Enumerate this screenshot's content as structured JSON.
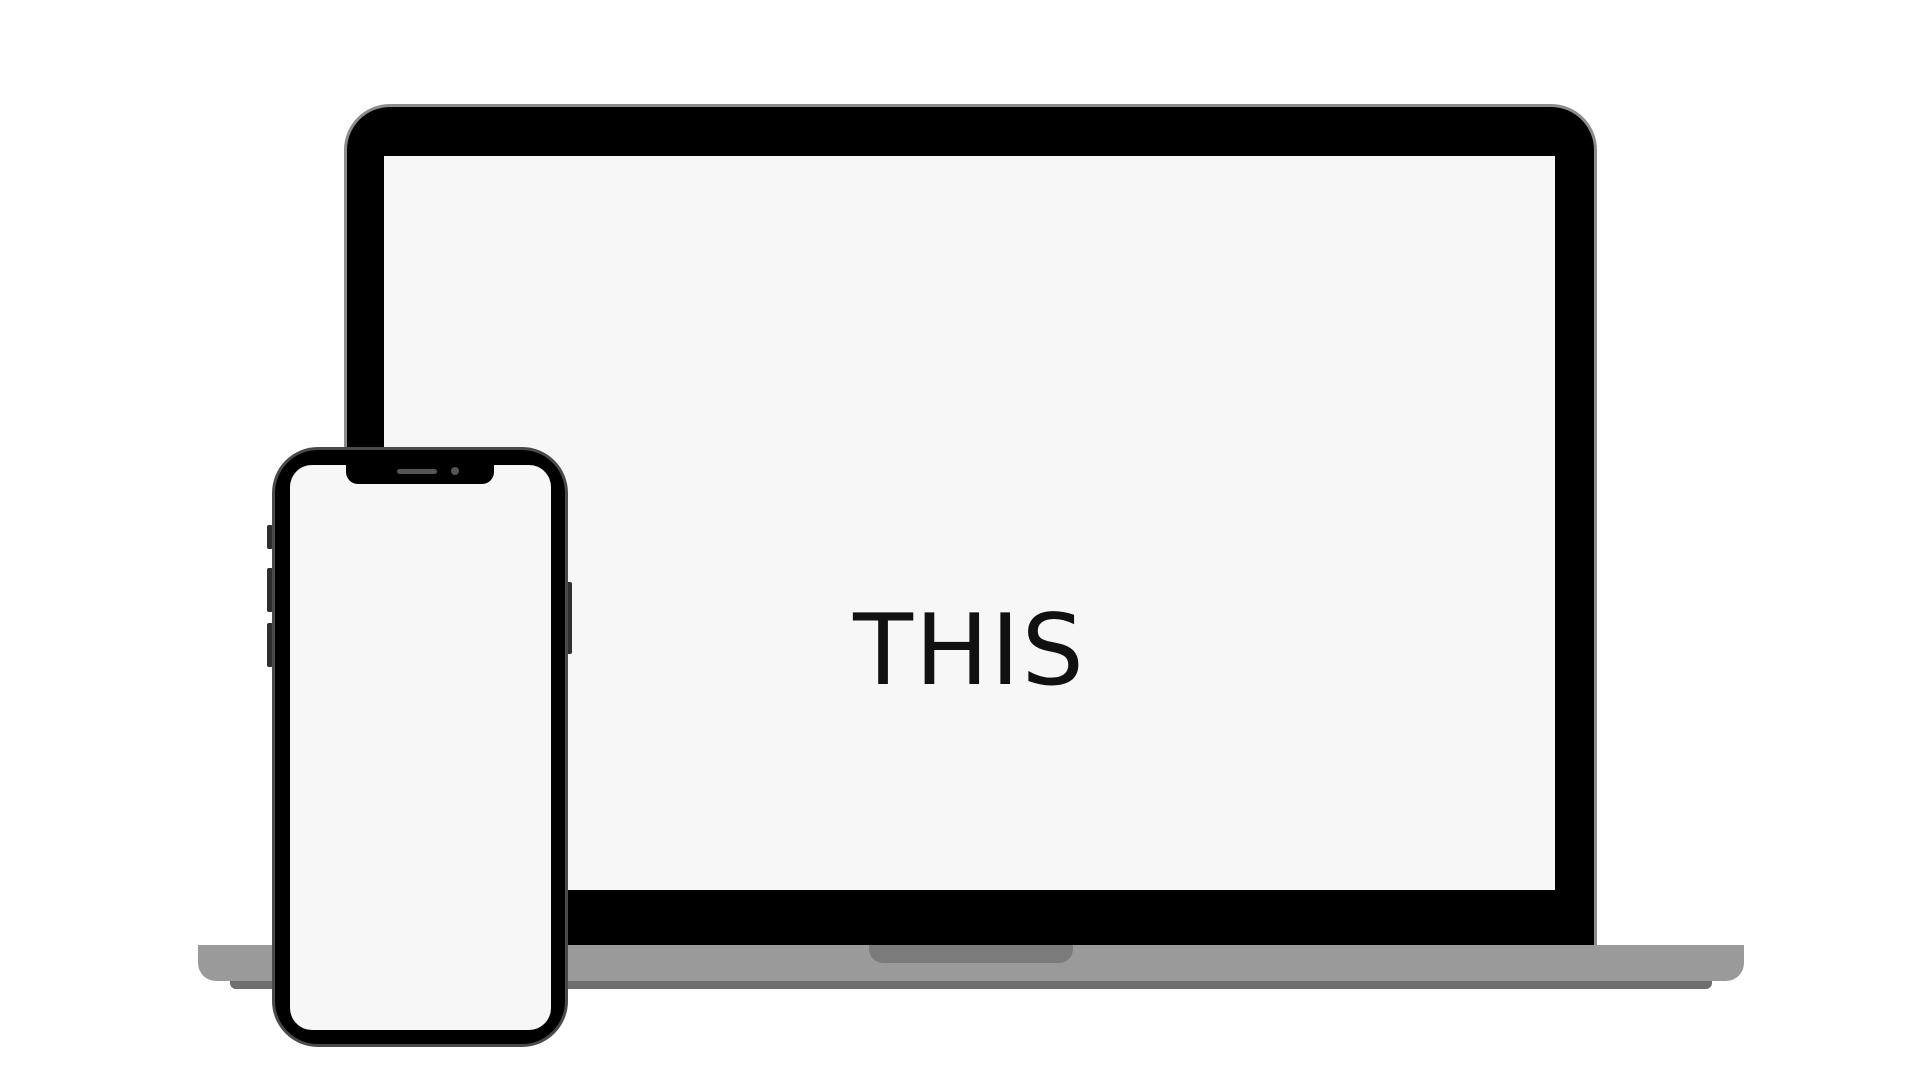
{
  "laptop": {
    "screen_text": "THIS",
    "colors": {
      "bezel": "#000000",
      "screen": "#f7f7f7",
      "body": "#9a9a9a",
      "notch": "#7b7b7b"
    }
  },
  "phone": {
    "colors": {
      "bezel": "#000000",
      "screen": "#f7f7f7",
      "frame": "#4a4a4a"
    }
  }
}
